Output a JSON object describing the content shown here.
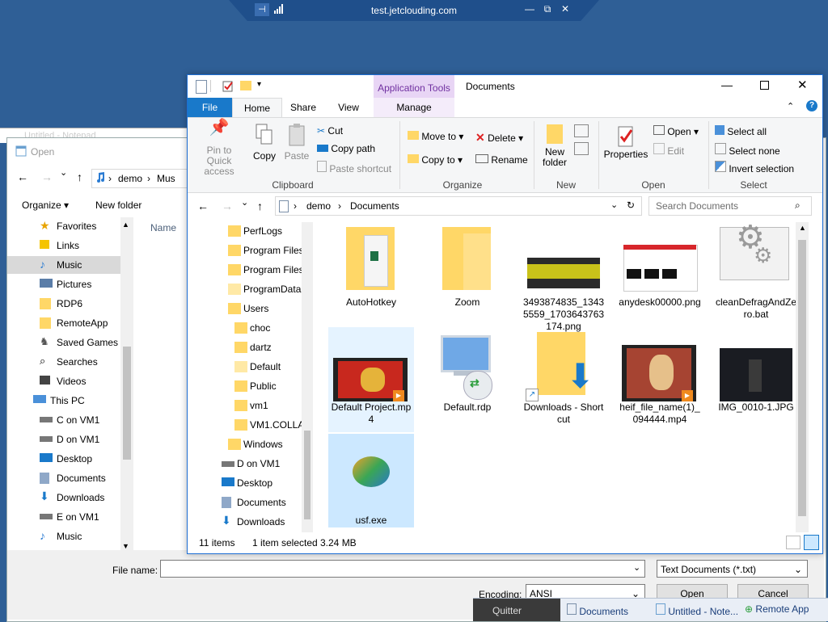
{
  "remote": {
    "title": "test.jetclouding.com",
    "min": "—",
    "restore": "⧉",
    "close": "✕"
  },
  "notepad_bg": {
    "title": "Untitled - Notepad"
  },
  "open_dialog": {
    "title": "Open",
    "path": [
      "demo",
      "Mus"
    ],
    "organize": "Organize ▾",
    "new_folder": "New folder",
    "column_name": "Name",
    "tree": [
      "Favorites",
      "Links",
      "Music",
      "Pictures",
      "RDP6",
      "RemoteApp",
      "Saved Games",
      "Searches",
      "Videos",
      "This PC",
      "C on VM1",
      "D on VM1",
      "Desktop",
      "Documents",
      "Downloads",
      "E on VM1",
      "Music"
    ],
    "file_name_label": "File name:",
    "file_name_value": "",
    "file_type": "Text Documents (*.txt)",
    "encoding_label": "Encoding:",
    "encoding_value": "ANSI",
    "open_btn": "Open",
    "cancel_btn": "Cancel"
  },
  "explorer": {
    "title": "Documents",
    "context_tab": "Application Tools",
    "tabs": [
      "File",
      "Home",
      "Share",
      "View",
      "Manage"
    ],
    "ribbon": {
      "pin": "Pin to Quick access",
      "copy": "Copy",
      "paste": "Paste",
      "cut": "Cut",
      "copy_path": "Copy path",
      "paste_shortcut": "Paste shortcut",
      "move_to": "Move to ▾",
      "copy_to": "Copy to ▾",
      "delete": "Delete ▾",
      "rename": "Rename",
      "new_folder": "New folder",
      "properties": "Properties",
      "open": "Open ▾",
      "edit": "Edit",
      "select_all": "Select all",
      "select_none": "Select none",
      "invert_selection": "Invert selection",
      "groups": [
        "Clipboard",
        "Organize",
        "New",
        "Open",
        "Select"
      ]
    },
    "address": [
      "demo",
      "Documents"
    ],
    "search_placeholder": "Search Documents",
    "nav_tree": [
      "PerfLogs",
      "Program Files",
      "Program Files",
      "ProgramData",
      "Users",
      "choc",
      "dartz",
      "Default",
      "Public",
      "vm1",
      "VM1.COLLA",
      "Windows",
      "D on VM1",
      "Desktop",
      "Documents",
      "Downloads"
    ],
    "files": [
      "AutoHotkey",
      "Zoom",
      "3493874835_13435559_1703643763174.png",
      "anydesk00000.png",
      "cleanDefragAndZero.bat",
      "Default Project.mp4",
      "Default.rdp",
      "Downloads - Shortcut",
      "heif_file_name(1)_094444.mp4",
      "IMG_0010-1.JPG",
      "usf.exe"
    ],
    "status_count": "11 items",
    "status_selected": "1 item selected",
    "status_size": "3.24 MB"
  },
  "taskbar": {
    "items": [
      "Quitter",
      "Documents",
      "Untitled - Note...",
      "Remote App"
    ]
  },
  "colors": {
    "accent": "#1979ca",
    "selection": "#cce8ff",
    "folder": "#ffd767",
    "context_tab": "#e8d5f5"
  }
}
